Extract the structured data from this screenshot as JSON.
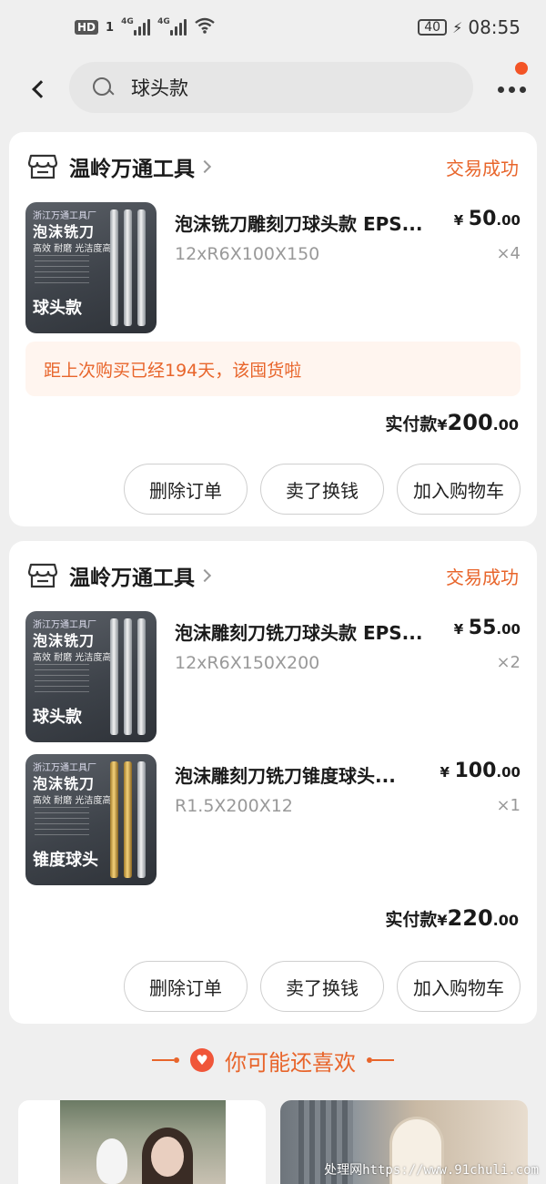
{
  "status_bar": {
    "hd": "HD",
    "sim": "1",
    "network1": "4G",
    "network2": "4G",
    "battery": "40",
    "time": "08:55"
  },
  "search": {
    "query": "球头款"
  },
  "orders": [
    {
      "shop_name": "温岭万通工具",
      "status": "交易成功",
      "items": [
        {
          "title": "泡沫铣刀雕刻刀球头款 EPS...",
          "spec": "12xR6X100X150",
          "price_currency": "¥",
          "price_int": "50",
          "price_dec": ".00",
          "qty": "×4",
          "thumb_maker": "浙江万通工具厂",
          "thumb_title": "泡沫铣刀",
          "thumb_sub": "高效 耐磨 光洁度高",
          "thumb_label": "球头款"
        }
      ],
      "notice": "距上次购买已经194天，该囤货啦",
      "total_label": "实付款",
      "total_currency": "¥",
      "total_int": "200",
      "total_dec": ".00",
      "buttons": [
        "删除订单",
        "卖了换钱",
        "加入购物车"
      ]
    },
    {
      "shop_name": "温岭万通工具",
      "status": "交易成功",
      "items": [
        {
          "title": "泡沫雕刻刀铣刀球头款 EPS...",
          "spec": "12xR6X150X200",
          "price_currency": "¥",
          "price_int": "55",
          "price_dec": ".00",
          "qty": "×2",
          "thumb_maker": "浙江万通工具厂",
          "thumb_title": "泡沫铣刀",
          "thumb_sub": "高效 耐磨 光洁度高",
          "thumb_label": "球头款"
        },
        {
          "title": "泡沫雕刻刀铣刀锥度球头...",
          "spec": "R1.5X200X12",
          "price_currency": "¥",
          "price_int": "100",
          "price_dec": ".00",
          "qty": "×1",
          "thumb_maker": "浙江万通工具厂",
          "thumb_title": "泡沫铣刀",
          "thumb_sub": "高效 耐磨 光洁度高",
          "thumb_label": "锥度球头"
        }
      ],
      "total_label": "实付款",
      "total_currency": "¥",
      "total_int": "220",
      "total_dec": ".00",
      "buttons": [
        "删除订单",
        "卖了换钱",
        "加入购物车"
      ]
    }
  ],
  "recommend": {
    "title": "你可能还喜欢"
  },
  "watermark": "处理网https://www.91chuli.com",
  "colors": {
    "accent": "#e8652b",
    "notice_bg": "#fff5ef",
    "badge_red": "#f35426"
  },
  "icons": {
    "back": "chevron-left-icon",
    "search": "search-icon",
    "more": "more-dots-icon",
    "shop": "shop-icon",
    "heart": "heart-icon"
  }
}
